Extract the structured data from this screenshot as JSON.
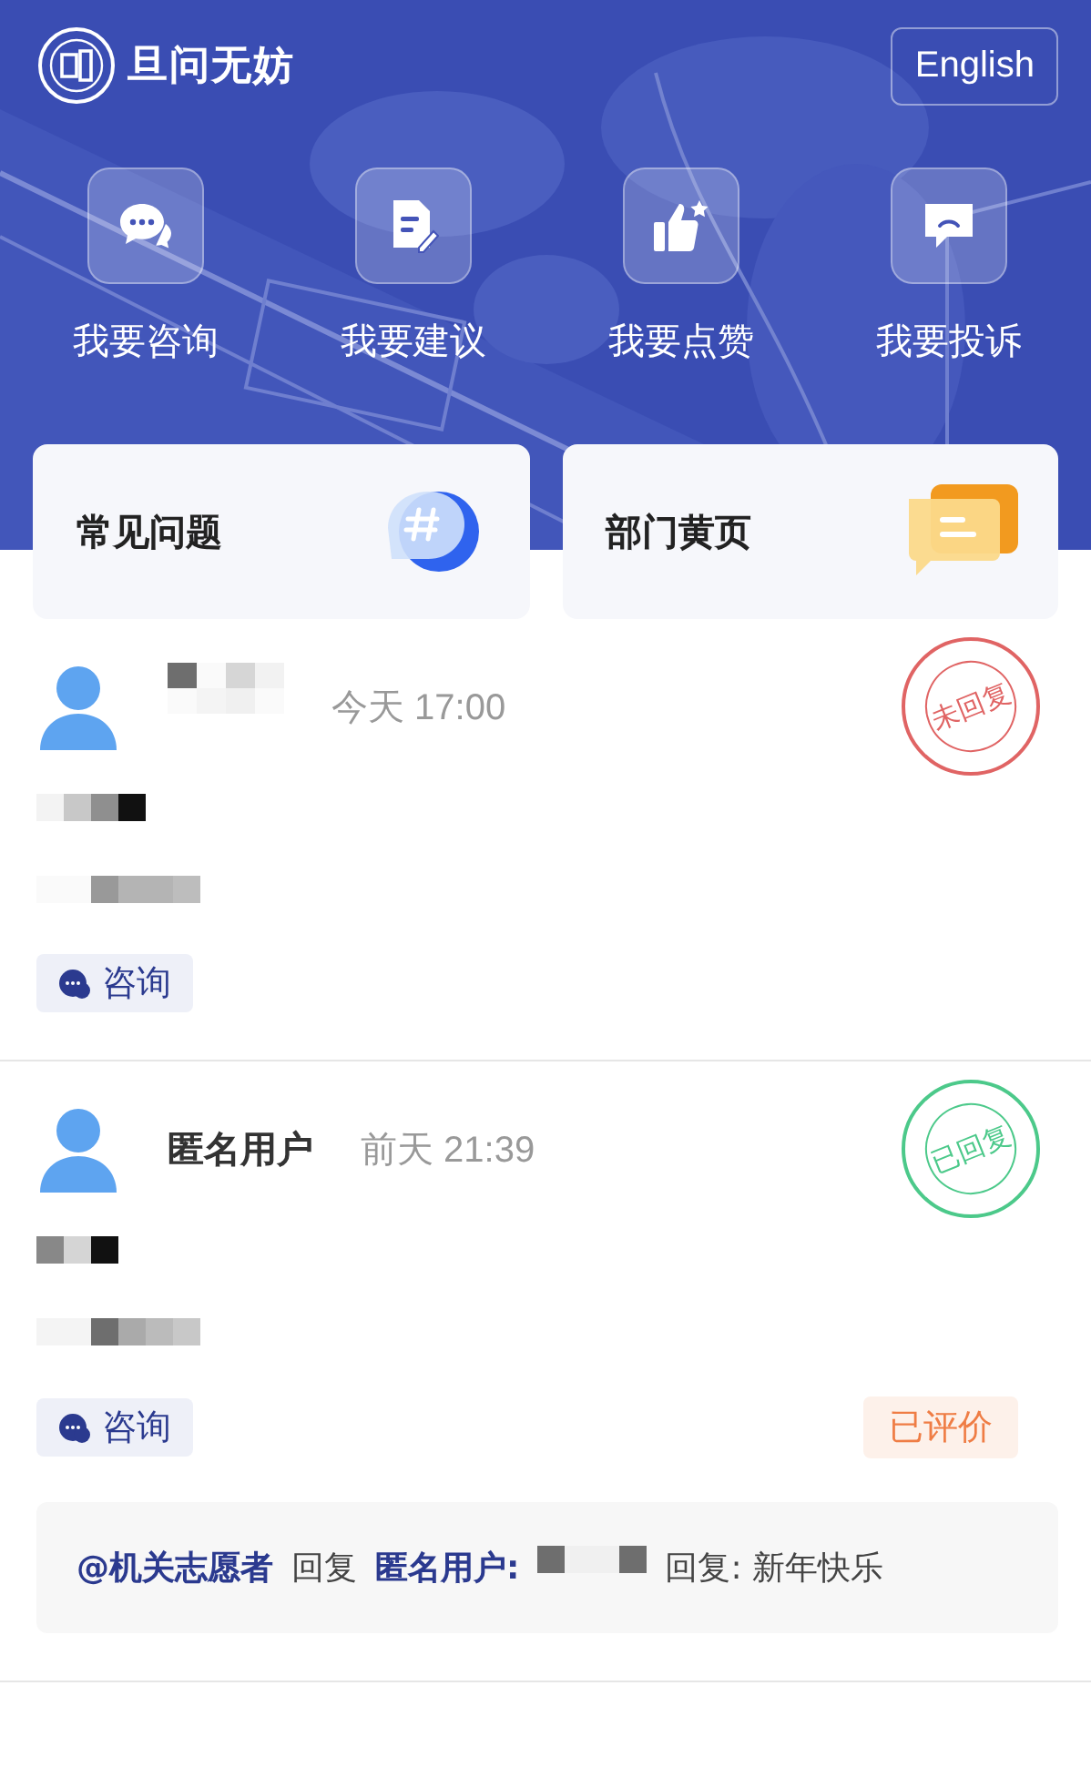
{
  "header": {
    "brand": "旦问无妨",
    "language_button": "English"
  },
  "actions": [
    {
      "kind": "chat",
      "label": "我要咨询"
    },
    {
      "kind": "edit",
      "label": "我要建议"
    },
    {
      "kind": "like",
      "label": "我要点赞"
    },
    {
      "kind": "complaint",
      "label": "我要投诉"
    }
  ],
  "shortcuts": [
    {
      "kind": "hash",
      "label": "常见问题"
    },
    {
      "kind": "pages",
      "label": "部门黄页"
    }
  ],
  "posts": [
    {
      "author": {
        "redacted": true
      },
      "time": "今天 17:00",
      "status": {
        "text": "未回复",
        "color": "#e06464"
      },
      "content": [
        {
          "kind": "mosaic"
        },
        {
          "kind": "mosaic"
        }
      ],
      "tag": "咨询"
    },
    {
      "author": {
        "redacted": false,
        "name": "匿名用户"
      },
      "time": "前天 21:39",
      "status": {
        "text": "已回复",
        "color": "#4cc98a"
      },
      "content": [
        {
          "kind": "mosaic"
        },
        {
          "kind": "mosaic"
        }
      ],
      "tag": "咨询",
      "rating": "已评价",
      "reply": [
        {
          "kind": "user",
          "text": "@机关志愿者"
        },
        {
          "kind": "text",
          "text": "回复"
        },
        {
          "kind": "user",
          "text": "匿名用户:"
        },
        {
          "kind": "mosaic"
        },
        {
          "kind": "text",
          "text": "回复:  新年快乐"
        }
      ]
    }
  ]
}
